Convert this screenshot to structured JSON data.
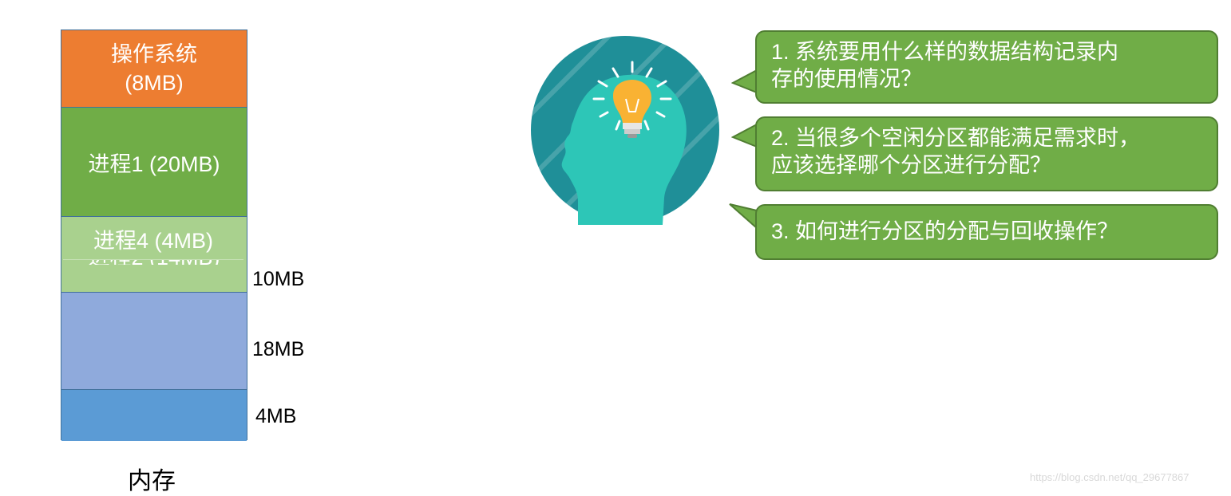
{
  "memory": {
    "os_label": "操作系统",
    "os_size": "(8MB)",
    "process1": "进程1 (20MB)",
    "process4": "进程4 (4MB)",
    "process2_partial": "进程2 (14MB)",
    "labels": {
      "p2_free": "10MB",
      "free_18": "18MB",
      "free_4": "4MB"
    },
    "caption": "内存"
  },
  "questions": {
    "q1_line1": "1. 系统要用什么样的数据结构记录内",
    "q1_line2": "存的使用情况？",
    "q2_line1": "2. 当很多个空闲分区都能满足需求时，",
    "q2_line2": "应该选择哪个分区进行分配？",
    "q3": "3. 如何进行分区的分配与回收操作？"
  },
  "icon": "head-lightbulb-icon",
  "colors": {
    "os": "#ed7d31",
    "process": "#70ad47",
    "process_light": "#a9d18e",
    "free_light": "#8faadc",
    "free_dark": "#5b9bd5",
    "circle": "#1f8f98",
    "head": "#2dc6b7",
    "bulb": "#f9b233"
  },
  "watermark": "https://blog.csdn.net/qq_29677867"
}
